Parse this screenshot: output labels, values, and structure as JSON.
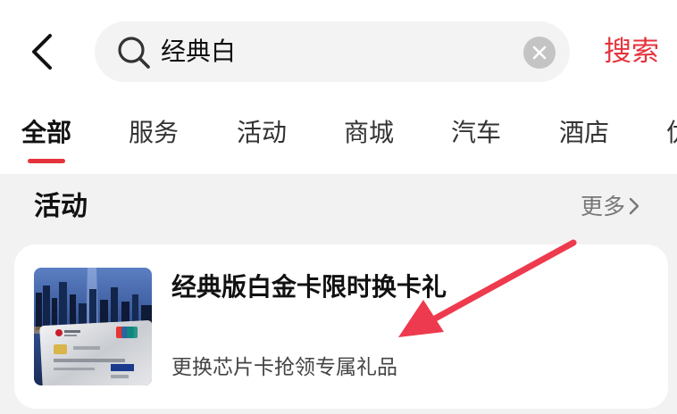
{
  "header": {
    "search_query": "经典白",
    "search_button_label": "搜索"
  },
  "tabs": [
    {
      "label": "全部"
    },
    {
      "label": "服务"
    },
    {
      "label": "活动"
    },
    {
      "label": "商城"
    },
    {
      "label": "汽车"
    },
    {
      "label": "酒店"
    },
    {
      "label": "优"
    }
  ],
  "section": {
    "title": "活动",
    "more_label": "更多"
  },
  "result_card": {
    "title": "经典版白金卡限时换卡礼",
    "subtitle": "更换芯片卡抢领专属礼品",
    "thumbnail_icon": "credit-card-image"
  },
  "colors": {
    "accent": "#e5333c",
    "annotation_arrow": "#ee3a4e"
  }
}
